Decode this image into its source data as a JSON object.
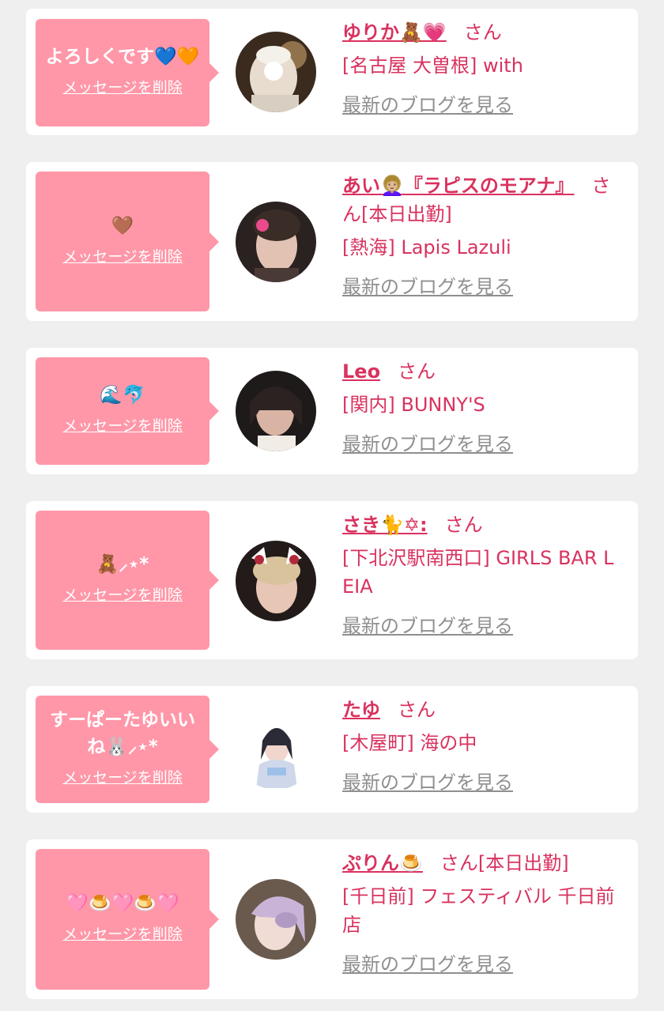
{
  "delete_label": "メッセージを削除",
  "blog_label": "最新のブログを見る",
  "san_label": "さん",
  "colors": {
    "background": "#efefef",
    "card": "#ffffff",
    "bubble": "#ff97a8",
    "accent": "#d9325e",
    "link_gray": "#8f8f8f"
  },
  "cards": [
    {
      "message": "よろしくです💙🧡",
      "cast_name": "ゆりか🧸💗",
      "suffix": "",
      "shop": "[名古屋 大曽根] with"
    },
    {
      "message": "🤎",
      "cast_name": "あい👩🏼‍🦱『ラピスのモアナ』",
      "suffix": "[本日出勤]",
      "shop": "[熱海] Lapis Lazuli"
    },
    {
      "message": "🌊🐬",
      "cast_name": "Leo",
      "suffix": "",
      "shop": "[関内] BUNNY'S"
    },
    {
      "message": "🧸⸝⋆*",
      "cast_name": "さき🐈✡︎:",
      "suffix": "",
      "shop": "[下北沢駅南西口] GIRLS BAR LEIA"
    },
    {
      "message": "すーぱーたゆいいね🐰⸝⋆*",
      "cast_name": "たゆ",
      "suffix": "",
      "shop": "[木屋町] 海の中"
    },
    {
      "message": "🩷🍮🩷🍮🩷",
      "cast_name": "ぷりん🍮",
      "suffix": "[本日出勤]",
      "shop": "[千日前] フェスティバル 千日前店"
    }
  ]
}
